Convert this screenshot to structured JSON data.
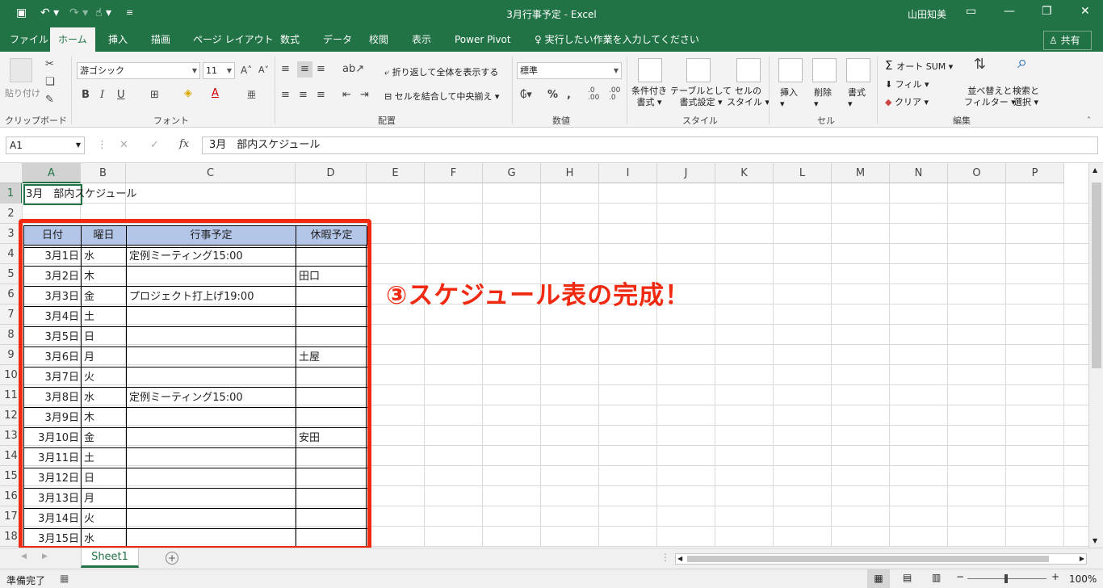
{
  "window": {
    "title": "3月行事予定 - Excel",
    "user": "山田知美",
    "share_label": "共有"
  },
  "tabs": [
    "ファイル",
    "ホーム",
    "挿入",
    "描画",
    "ページ レイアウト",
    "数式",
    "データ",
    "校閲",
    "表示",
    "Power Pivot"
  ],
  "tellme": "実行したい作業を入力してください",
  "ribbon": {
    "clipboard": {
      "label": "クリップボード",
      "paste": "貼り付け"
    },
    "font": {
      "label": "フォント",
      "name": "游ゴシック",
      "size": "11",
      "bold": "B",
      "italic": "I",
      "underline": "U"
    },
    "alignment": {
      "label": "配置",
      "wrap": "折り返して全体を表示する",
      "merge": "セルを結合して中央揃え"
    },
    "number": {
      "label": "数値",
      "format": "標準",
      "percent": "%",
      "dec_inc": ".0\n.00",
      "dec_dec": ".00\n.0"
    },
    "styles": {
      "label": "スタイル",
      "conditional": [
        "条件付き",
        "書式"
      ],
      "table": [
        "テーブルとして",
        "書式設定"
      ],
      "cell": [
        "セルの",
        "スタイル"
      ]
    },
    "cells": {
      "label": "セル",
      "insert": "挿入",
      "delete": "削除",
      "format": "書式"
    },
    "editing": {
      "label": "編集",
      "autosum": "オート SUM",
      "fill": "フィル",
      "clear": "クリア",
      "sort": [
        "並べ替えと",
        "フィルター"
      ],
      "find": [
        "検索と",
        "選択"
      ]
    }
  },
  "formula_bar": {
    "namebox": "A1",
    "fx": "fx",
    "content": "3月　部内スケジュール"
  },
  "columns": [
    "A",
    "B",
    "C",
    "D",
    "E",
    "F",
    "G",
    "H",
    "I",
    "J",
    "K",
    "L",
    "M",
    "N",
    "O",
    "P"
  ],
  "rows": [
    "1",
    "2",
    "3",
    "4",
    "5",
    "6",
    "7",
    "8",
    "9",
    "10",
    "11",
    "12",
    "13",
    "14",
    "15",
    "16",
    "17",
    "18"
  ],
  "sheet": {
    "a1": "3月　部内スケジュール",
    "headers": [
      "日付",
      "曜日",
      "行事予定",
      "休暇予定"
    ],
    "records": [
      [
        "3月1日",
        "水",
        "定例ミーティング15:00",
        ""
      ],
      [
        "3月2日",
        "木",
        "",
        "田口"
      ],
      [
        "3月3日",
        "金",
        "プロジェクト打上げ19:00",
        ""
      ],
      [
        "3月4日",
        "土",
        "",
        ""
      ],
      [
        "3月5日",
        "日",
        "",
        ""
      ],
      [
        "3月6日",
        "月",
        "",
        "土屋"
      ],
      [
        "3月7日",
        "火",
        "",
        ""
      ],
      [
        "3月8日",
        "水",
        "定例ミーティング15:00",
        ""
      ],
      [
        "3月9日",
        "木",
        "",
        ""
      ],
      [
        "3月10日",
        "金",
        "",
        "安田"
      ],
      [
        "3月11日",
        "土",
        "",
        ""
      ],
      [
        "3月12日",
        "日",
        "",
        ""
      ],
      [
        "3月13日",
        "月",
        "",
        ""
      ],
      [
        "3月14日",
        "火",
        "",
        ""
      ],
      [
        "3月15日",
        "水",
        "",
        ""
      ]
    ]
  },
  "callout": "③スケジュール表の完成！",
  "sheet_tab": "Sheet1",
  "status": {
    "ready": "準備完了",
    "zoom": "100%"
  },
  "colors": {
    "accent": "#217346",
    "callout": "#f02a11",
    "header_fill": "#b4c6e7"
  }
}
